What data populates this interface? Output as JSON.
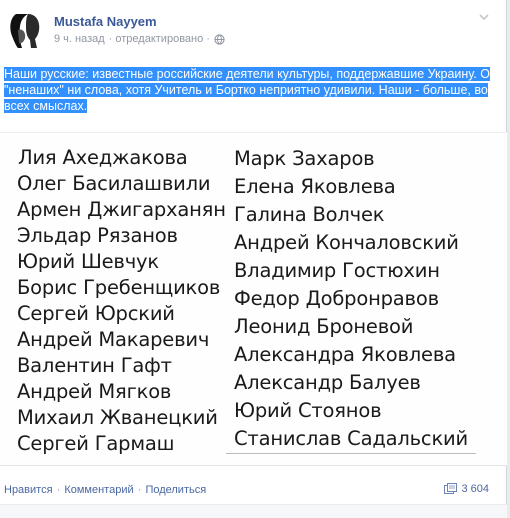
{
  "post": {
    "author": "Mustafa Nayyem",
    "time": "9 ч. назад",
    "edited": "· отредактировано ·",
    "text": "Наши русские: известные российские деятели культуры, поддержавшие Украину. О \"ненаших\" ни слова, хотя Учитель и Бортко неприятно удивили. Наши - больше, во всех смыслах."
  },
  "photo": {
    "left_names": [
      "Лия Ахеджакова",
      "Олег Басилашвили",
      "Армен Джигарханян",
      "Эльдар Рязанов",
      "Юрий Шевчук",
      "Борис Гребенщиков",
      "Сергей Юрский",
      "Андрей Макаревич",
      "Валентин Гафт",
      "Андрей Мягков",
      "Михаил Жванецкий",
      "Сергей Гармаш"
    ],
    "right_names": [
      "Марк Захаров",
      "Елена Яковлева",
      "Галина Волчек",
      "Андрей Кончаловский",
      "Владимир Гостюхин",
      "Федор Добронравов",
      "Леонид Броневой",
      "Александра Яковлева",
      "Александр Балуев",
      "Юрий Стоянов",
      "Станислав Садальский"
    ]
  },
  "footer": {
    "like": "Нравится",
    "comment": "Комментарий",
    "share": "Поделиться",
    "share_count": "3 604"
  },
  "icons": {
    "avatar": "profile-photo",
    "globe": "globe-icon",
    "chevron": "chevron-down-icon",
    "share": "share-icon"
  },
  "colors": {
    "link": "#3b5998",
    "highlight": "#3390ff",
    "meta": "#9197a3"
  }
}
